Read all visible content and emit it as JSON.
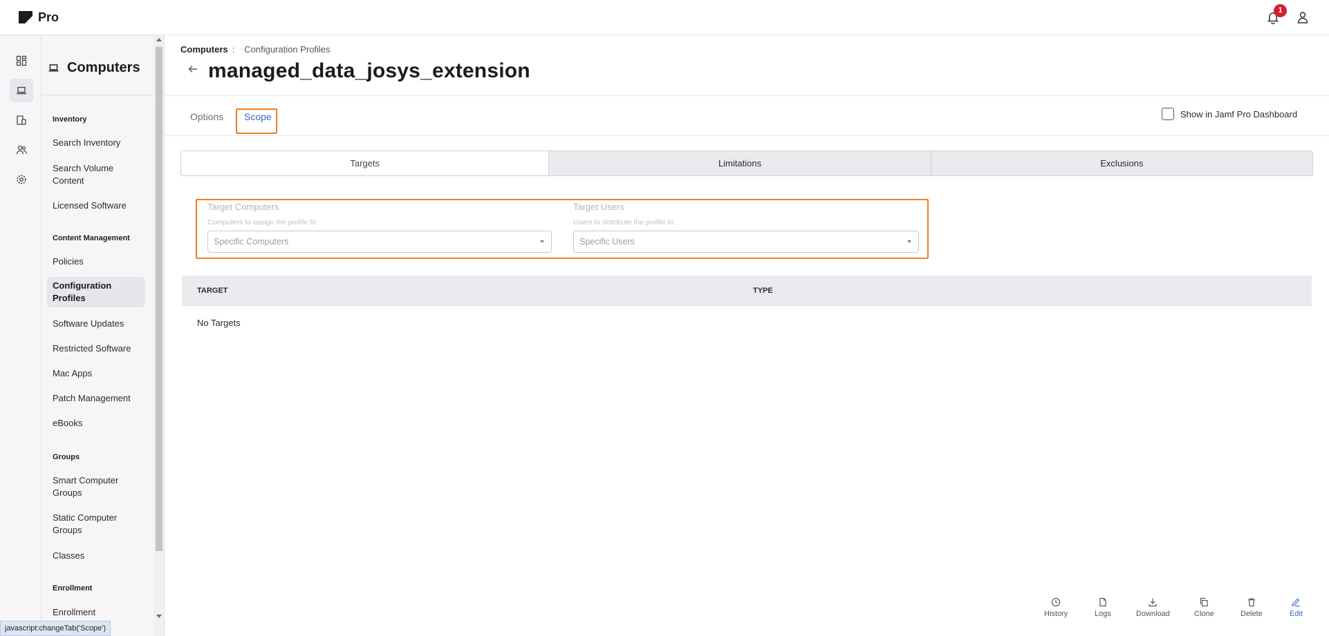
{
  "app": {
    "brand": "Pro",
    "notification_count": "1"
  },
  "rail": [
    "dashboard-icon",
    "computer-icon",
    "devices-icon",
    "users-icon",
    "settings-icon"
  ],
  "sidebar": {
    "title": "Computers",
    "sections": [
      {
        "heading": "Inventory",
        "items": [
          "Search Inventory",
          "Search Volume Content",
          "Licensed Software"
        ]
      },
      {
        "heading": "Content Management",
        "items": [
          "Policies",
          "Configuration Profiles",
          "Software Updates",
          "Restricted Software",
          "Mac Apps",
          "Patch Management",
          "eBooks"
        ]
      },
      {
        "heading": "Groups",
        "items": [
          "Smart Computer Groups",
          "Static Computer Groups",
          "Classes"
        ]
      },
      {
        "heading": "Enrollment",
        "items": [
          "Enrollment"
        ]
      }
    ],
    "active_item": "Configuration Profiles"
  },
  "breadcrumb": {
    "root": "Computers",
    "separator": ":",
    "current": "Configuration Profiles"
  },
  "page": {
    "title": "managed_data_josys_extension"
  },
  "tabs": [
    {
      "label": "Options"
    },
    {
      "label": "Scope"
    }
  ],
  "active_tab": "Scope",
  "dashboard_checkbox": {
    "label": "Show in Jamf Pro Dashboard",
    "checked": false
  },
  "scope_tabs": [
    {
      "label": "Targets"
    },
    {
      "label": "Limitations"
    },
    {
      "label": "Exclusions"
    }
  ],
  "active_scope_tab": "Targets",
  "targets": {
    "computers": {
      "label": "Target Computers",
      "help": "Computers to assign the profile to",
      "value": "Specific Computers"
    },
    "users": {
      "label": "Target Users",
      "help": "Users to distribute the profile to",
      "value": "Specific Users"
    }
  },
  "table": {
    "columns": [
      "TARGET",
      "TYPE"
    ],
    "empty_text": "No Targets"
  },
  "footer_actions": [
    {
      "label": "History",
      "icon": "clock-icon"
    },
    {
      "label": "Logs",
      "icon": "file-icon"
    },
    {
      "label": "Download",
      "icon": "download-icon"
    },
    {
      "label": "Clone",
      "icon": "copy-icon"
    },
    {
      "label": "Delete",
      "icon": "trash-icon"
    },
    {
      "label": "Edit",
      "icon": "edit-icon"
    }
  ],
  "status_bar": "javascript:changeTab('Scope')",
  "colors": {
    "accent": "#3468c9",
    "highlight": "#f07d1f",
    "badge": "#d1202f"
  }
}
